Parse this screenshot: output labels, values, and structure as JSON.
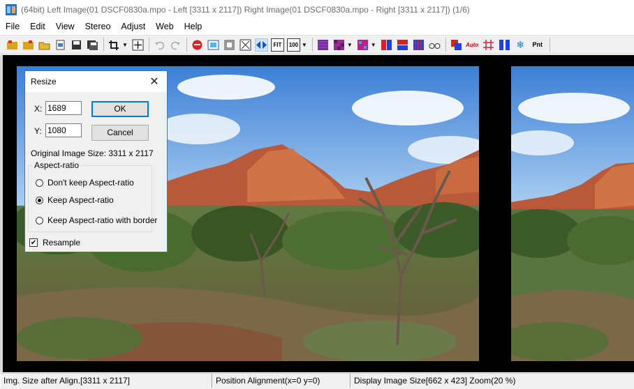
{
  "window": {
    "title": "(64bit) Left Image(01 DSCF0830a.mpo - Left [3311 x 2117]) Right Image(01 DSCF0830a.mpo - Right [3311 x 2117])  (1/6)"
  },
  "menu": [
    "File",
    "Edit",
    "View",
    "Stereo",
    "Adjust",
    "Web",
    "Help"
  ],
  "toolbar": {
    "fit_label": "FIT",
    "zoom100_label": "100",
    "auto_label": "Auto",
    "pnt_label": "Pnt"
  },
  "dialog": {
    "title": "Resize",
    "x_label": "X:",
    "x_value": "1689",
    "y_label": "Y:",
    "y_value": "1080",
    "ok_label": "OK",
    "cancel_label": "Cancel",
    "original_size": "Original Image Size: 3311 x 2117",
    "aspect_group": "Aspect-ratio",
    "options": [
      "Don't keep Aspect-ratio",
      "Keep Aspect-ratio",
      "Keep Aspect-ratio with border"
    ],
    "selected_option": "Keep Aspect-ratio",
    "resample_label": "Resample",
    "resample_checked": true
  },
  "status": {
    "size_after_align": "Img. Size after Align.[3311 x 2117]",
    "position_alignment": "Position Alignment(x=0 y=0)",
    "display_size": "Display Image Size[662 x 423]  Zoom(20 %)"
  }
}
